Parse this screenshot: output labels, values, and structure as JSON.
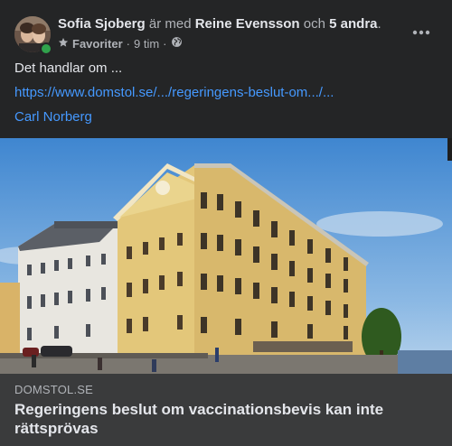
{
  "post": {
    "author": "Sofia Sjoberg",
    "with_text": "är med",
    "tagged": "Reine Evensson",
    "and_text": "och",
    "others": "5 andra",
    "period": ".",
    "audience": "Favoriter",
    "separator": "·",
    "time": "9 tim",
    "text": "Det handlar om ...",
    "link": "https://www.domstol.se/.../regeringens-beslut-om.../...",
    "mention": "Carl Norberg"
  },
  "preview": {
    "domain": "DOMSTOL.SE",
    "headline": "Regeringens beslut om vaccinationsbevis kan inte rättsprövas"
  },
  "colors": {
    "background": "#242526",
    "footer": "#3a3b3c",
    "link": "#4599ff",
    "online": "#31a24c"
  },
  "icons": {
    "audience": "star-icon",
    "privacy": "globe-icon",
    "more": "more-options-icon"
  }
}
